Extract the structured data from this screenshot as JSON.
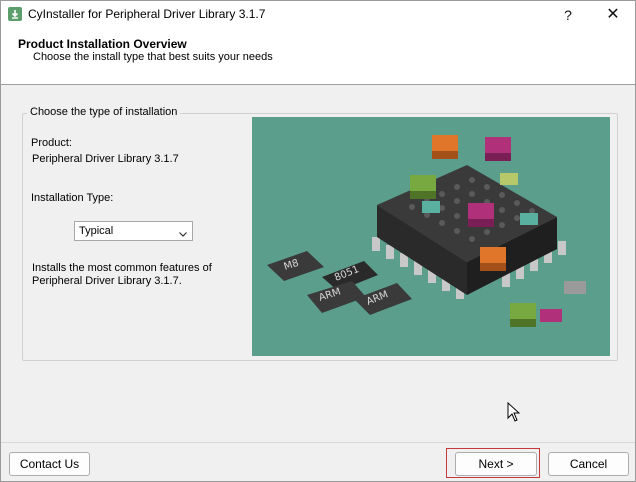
{
  "window": {
    "title": "CyInstaller for Peripheral Driver Library 3.1.7",
    "help_glyph": "?",
    "close_glyph": "✕"
  },
  "header": {
    "title": "Product  Installation Overview",
    "subtitle": "Choose the install type that best suits your needs"
  },
  "group": {
    "legend": "Choose the type of installation",
    "product_label": "Product:",
    "product_name": "Peripheral Driver Library 3.1.7",
    "type_label": "Installation Type:",
    "type_value": "Typical",
    "description": "Installs the most common features of Peripheral Driver Library 3.1.7."
  },
  "art": {
    "chip_labels": [
      "M8",
      "8051",
      "ARM",
      "ARM"
    ],
    "background": "#5c9e8c"
  },
  "footer": {
    "contact_label": "Contact Us",
    "next_label": "Next >",
    "cancel_label": "Cancel"
  },
  "colors": {
    "highlight_outline": "#c43a3a"
  }
}
